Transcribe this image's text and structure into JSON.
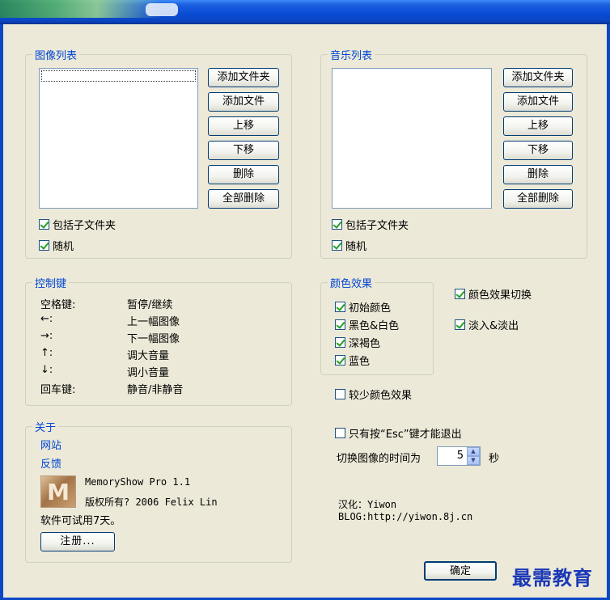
{
  "images": {
    "legend": "图像列表",
    "buttons": [
      "添加文件夹",
      "添加文件",
      "上移",
      "下移",
      "删除",
      "全部删除"
    ],
    "include_subfolders": {
      "label": "包括子文件夹",
      "checked": true
    },
    "random": {
      "label": "随机",
      "checked": true
    }
  },
  "music": {
    "legend": "音乐列表",
    "buttons": [
      "添加文件夹",
      "添加文件",
      "上移",
      "下移",
      "删除",
      "全部删除"
    ],
    "include_subfolders": {
      "label": "包括子文件夹",
      "checked": true
    },
    "random": {
      "label": "随机",
      "checked": true
    }
  },
  "controls": {
    "legend": "控制键",
    "rows": [
      {
        "key": "空格键:",
        "action": "暂停/继续"
      },
      {
        "key": "←:",
        "action": "上一幅图像"
      },
      {
        "key": "→:",
        "action": "下一幅图像"
      },
      {
        "key": "↑:",
        "action": "调大音量"
      },
      {
        "key": "↓:",
        "action": "调小音量"
      },
      {
        "key": "回车键:",
        "action": "静音/非静音"
      }
    ]
  },
  "color_effects": {
    "legend": "颜色效果",
    "items": [
      {
        "label": "初始颜色",
        "checked": true
      },
      {
        "label": "黑色&白色",
        "checked": true
      },
      {
        "label": "深褐色",
        "checked": true
      },
      {
        "label": "蓝色",
        "checked": true
      }
    ],
    "transition": {
      "label": "颜色效果切换",
      "checked": true
    },
    "fade": {
      "label": "淡入&淡出",
      "checked": true
    },
    "fewer": {
      "label": "较少颜色效果",
      "checked": false
    }
  },
  "options": {
    "esc_only": {
      "label": "只有按“Esc”键才能退出",
      "checked": false
    },
    "interval_label": "切换图像的时间为",
    "interval_value": "5",
    "interval_unit": "秒"
  },
  "about": {
    "legend": "关于",
    "website": "网站",
    "feedback": "反馈",
    "logo_letter": "M",
    "product": "MemoryShow Pro 1.1",
    "copyright": "版权所有? 2006 Felix Lin",
    "trial": "软件可试用7天。",
    "register": "注册..."
  },
  "credits": {
    "translator": "汉化：Yiwon",
    "blog": "BLOG:http://yiwon.8j.cn"
  },
  "ok_button": "确定",
  "watermark": "最需教育"
}
